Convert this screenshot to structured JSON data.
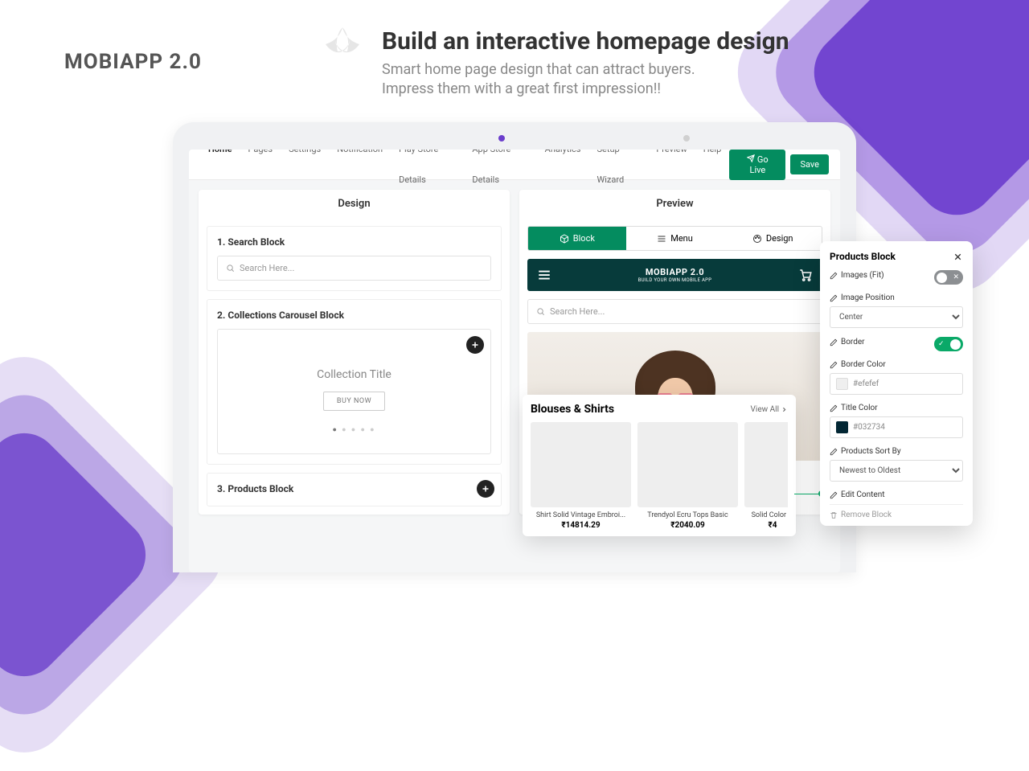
{
  "logo": "MOBIAPP 2.0",
  "headline": {
    "title": "Build an interactive homepage design",
    "sub1": "Smart home page design that can attract buyers.",
    "sub2": "Impress them with a great first impression!!"
  },
  "nav": {
    "items": [
      "Home",
      "Pages",
      "Settings",
      "Notification",
      "Play Store Details",
      "App Store Details",
      "Analytics",
      "Setup Wizard",
      "Preview",
      "Help"
    ],
    "active": 0,
    "golive": "Go Live",
    "save": "Save"
  },
  "panels": {
    "design": "Design",
    "preview": "Preview"
  },
  "blocks": {
    "search": {
      "title": "1. Search Block",
      "placeholder": "Search Here..."
    },
    "carousel": {
      "title": "2. Collections Carousel Block",
      "collectionTitle": "Collection Title",
      "buy": "BUY NOW"
    },
    "products": {
      "title": "3. Products Block"
    }
  },
  "preview": {
    "tabs": {
      "block": "Block",
      "menu": "Menu",
      "design": "Design"
    },
    "appbar": {
      "brand": "MOBIAPP 2.0",
      "sub": "BUILD YOUR OWN MOBILE APP"
    },
    "searchPlaceholder": "Search Here..."
  },
  "products": {
    "heading": "Blouses & Shirts",
    "viewAll": "View All",
    "items": [
      {
        "name": "Shirt Solid Vintage Embroi...",
        "price": "₹14814.29"
      },
      {
        "name": "Trendyol Ecru Tops Basic",
        "price": "₹2040.09"
      },
      {
        "name": "Solid Color ...",
        "price": "₹4"
      }
    ]
  },
  "settings": {
    "title": "Products Block",
    "imagesFit": "Images (Fit)",
    "imagePosition": {
      "label": "Image Position",
      "value": "Center"
    },
    "border": "Border",
    "borderColor": {
      "label": "Border Color",
      "value": "#efefef"
    },
    "titleColor": {
      "label": "Title Color",
      "value": "#032734"
    },
    "sortBy": {
      "label": "Products Sort By",
      "value": "Newest to Oldest"
    },
    "editContent": "Edit Content",
    "remove": "Remove Block"
  }
}
